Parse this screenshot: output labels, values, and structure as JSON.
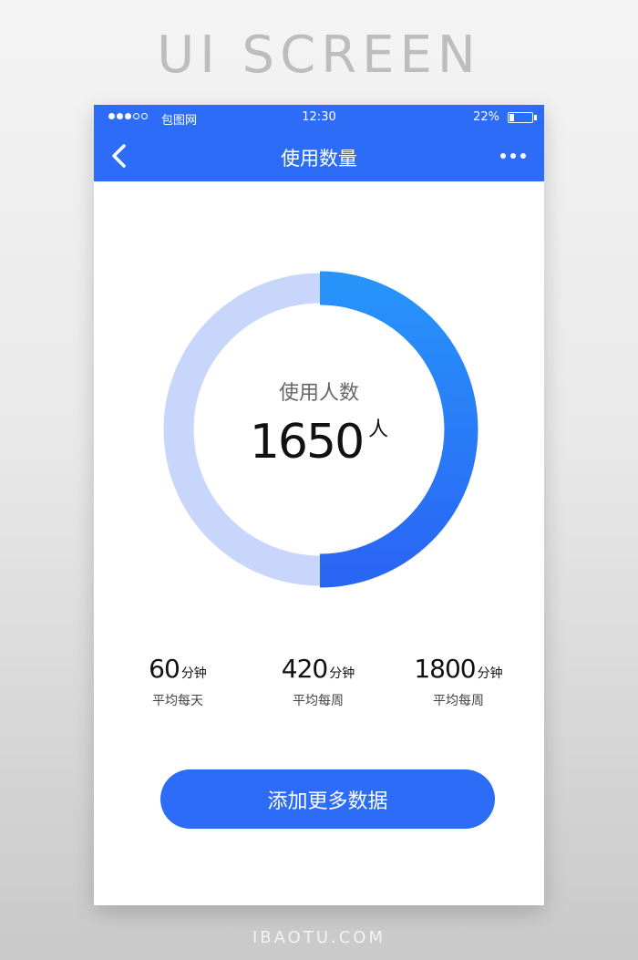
{
  "page": {
    "header": "UI SCREEN",
    "footer": "IBAOTU.COM"
  },
  "statusbar": {
    "carrier": "包图网",
    "time": "12:30",
    "battery": "22%",
    "battery_level": 0.22,
    "signal_bars_filled": 3,
    "signal_bars_total": 5
  },
  "navbar": {
    "title": "使用数量",
    "back_icon": "chevron-left-icon",
    "more_icon": "more-dots-icon"
  },
  "ring": {
    "label": "使用人数",
    "value": "1650",
    "unit": "人",
    "fraction": 0.5,
    "colors": {
      "track": "#c8d6fb",
      "progress_start": "#2893fb",
      "progress_end": "#2a66f4"
    }
  },
  "stats": [
    {
      "value": "60",
      "unit": "分钟",
      "label": "平均每天"
    },
    {
      "value": "420",
      "unit": "分钟",
      "label": "平均每周"
    },
    {
      "value": "1800",
      "unit": "分钟",
      "label": "平均每周"
    }
  ],
  "action": {
    "label": "添加更多数据"
  },
  "colors": {
    "primary": "#2d6cf7"
  }
}
